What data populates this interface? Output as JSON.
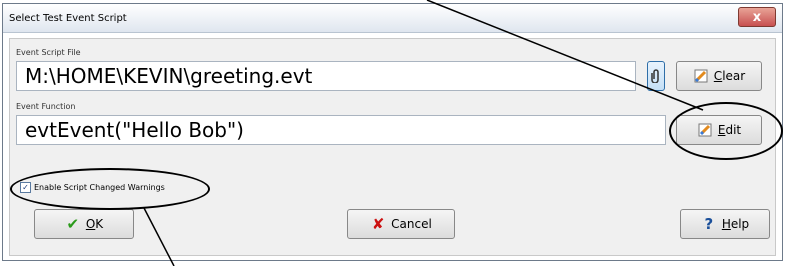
{
  "window": {
    "title": "Select Test Event Script",
    "close_glyph": "x"
  },
  "event_script_file": {
    "label": "Event Script File",
    "value": "M:\\HOME\\KEVIN\\greeting.evt"
  },
  "event_function": {
    "label": "Event Function",
    "value": "evtEvent(\"Hello Bob\")"
  },
  "buttons": {
    "browse": {
      "icon": "paperclip-icon"
    },
    "clear": {
      "label_prefix": "",
      "mnemonic": "C",
      "label_rest": "lear",
      "icon": "eraser-icon"
    },
    "edit": {
      "mnemonic": "E",
      "label_rest": "dit",
      "icon": "edit-icon"
    },
    "ok": {
      "mnemonic": "O",
      "label_rest": "K",
      "icon": "check-icon",
      "icon_color": "#2a9a1a"
    },
    "cancel": {
      "label": "Cancel",
      "icon": "x-icon",
      "icon_color": "#cc1111"
    },
    "help": {
      "mnemonic": "H",
      "label_rest": "elp",
      "icon": "question-icon",
      "icon_color": "#1a4f9a"
    }
  },
  "warnings_checkbox": {
    "label": "Enable Script Changed Warnings",
    "checked": true
  }
}
